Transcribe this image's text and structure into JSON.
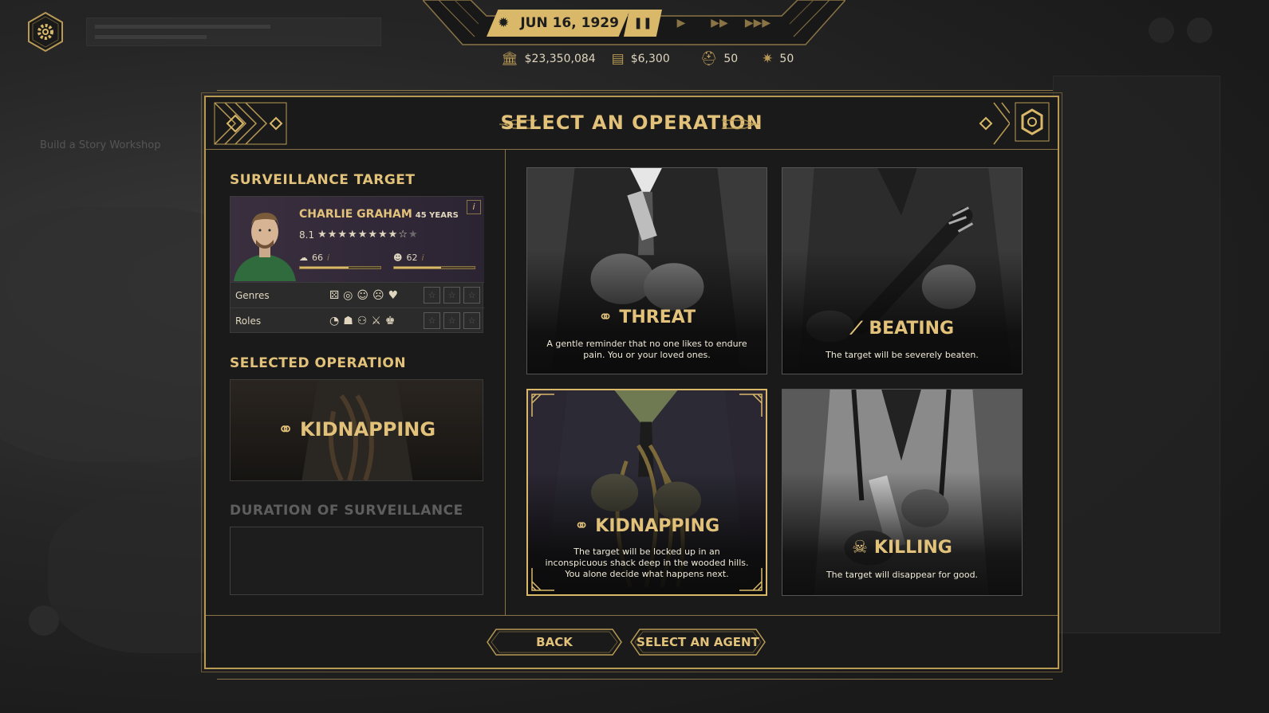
{
  "time": {
    "date": "JUN 16, 1929",
    "speeds": [
      "pause",
      "play",
      "fast",
      "fastest"
    ]
  },
  "stats": {
    "bank": "$23,350,084",
    "cash": "$6,300",
    "heat": "50",
    "influence": "50"
  },
  "dialog": {
    "title": "SELECT AN OPERATION"
  },
  "target": {
    "section_title": "SURVEILLANCE TARGET",
    "name": "CHARLIE GRAHAM",
    "age": "45 YEARS",
    "rating": "8.1",
    "stars_full": 8,
    "stars_half": 1,
    "stars_empty": 1,
    "stat1_value": "66",
    "stat1_fill": 0.6,
    "stat2_value": "62",
    "stat2_fill": 0.58,
    "info_label": "i",
    "genres_label": "Genres",
    "roles_label": "Roles"
  },
  "selected_operation": {
    "section_title": "SELECTED OPERATION",
    "name": "KIDNAPPING"
  },
  "duration": {
    "section_title": "DURATION OF SURVEILLANCE"
  },
  "operations": [
    {
      "name": "THREAT",
      "description": "A gentle reminder that no one likes to endure pain. You or your loved ones.",
      "icon": "brass-knuckles-icon"
    },
    {
      "name": "BEATING",
      "description": "The target will be severely beaten.",
      "icon": "bat-icon"
    },
    {
      "name": "KIDNAPPING",
      "description": "The target will be locked up in an inconspicuous shack deep in the wooded hills. You alone decide what happens next.",
      "icon": "rope-icon"
    },
    {
      "name": "KILLING",
      "description": "The target will disappear for good.",
      "icon": "skull-icon"
    }
  ],
  "footer": {
    "back": "BACK",
    "select_agent": "SELECT AN AGENT"
  },
  "background": {
    "hint": "Build a Story Workshop"
  },
  "colors": {
    "gold": "#d9b86a",
    "gold_dark": "#8a7446",
    "panel": "#1a1a1a"
  }
}
